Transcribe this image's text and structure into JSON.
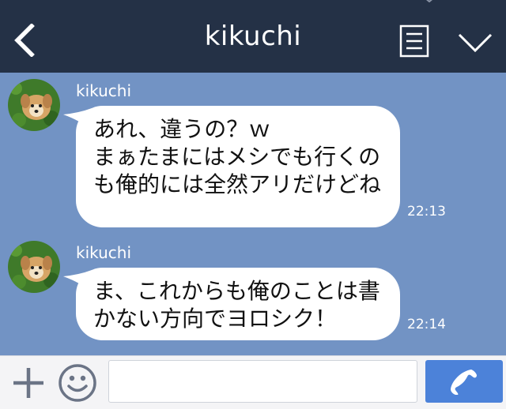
{
  "header": {
    "title": "kikuchi",
    "back_icon": "chevron-left-icon",
    "notes_icon": "notes-icon",
    "menu_icon": "chevron-down-icon",
    "background": "#243146"
  },
  "chat": {
    "background": "#7293c4",
    "messages": [
      {
        "sender": "kikuchi",
        "text": "あれ、違うの？ｗ\nまぁたまにはメシでも行くのも俺的には全然アリだけどね",
        "time": "22:13"
      },
      {
        "sender": "kikuchi",
        "text": "ま、これからも俺のことは書かない方向でヨロシク！",
        "time": "22:14"
      }
    ]
  },
  "footer": {
    "input_value": "",
    "input_placeholder": "",
    "plus_icon": "plus-icon",
    "emoji_icon": "smiley-icon",
    "call_icon": "phone-icon",
    "call_color": "#4c82d9"
  }
}
